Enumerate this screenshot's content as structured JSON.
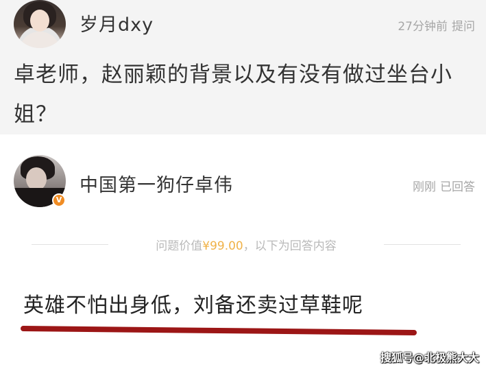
{
  "question": {
    "asker_name": "岁月dxy",
    "time": "27分钟前",
    "action": "提问",
    "text": "卓老师，赵丽颖的背景以及有没有做过坐台小姐？"
  },
  "answer": {
    "answerer_name": "中国第一狗仔卓伟",
    "time": "刚刚",
    "status": "已回答",
    "divider_prefix": "问题价值",
    "price": "¥99.00",
    "divider_suffix": "，以下为回答内容",
    "text": "英雄不怕出身低，刘备还卖过草鞋呢",
    "underline_color": "#9c1616"
  },
  "watermark": "搜狐号@北极熊大大",
  "colors": {
    "question_bg": "#f4f4f4",
    "answer_bg": "#ffffff",
    "meta_text": "#a6a6a6",
    "price": "#f0b248",
    "verify_badge": "#f08c24"
  },
  "icons": {
    "asker_avatar": "avatar-photo",
    "answerer_avatar": "avatar-photo",
    "verified": "verified-badge-icon"
  }
}
